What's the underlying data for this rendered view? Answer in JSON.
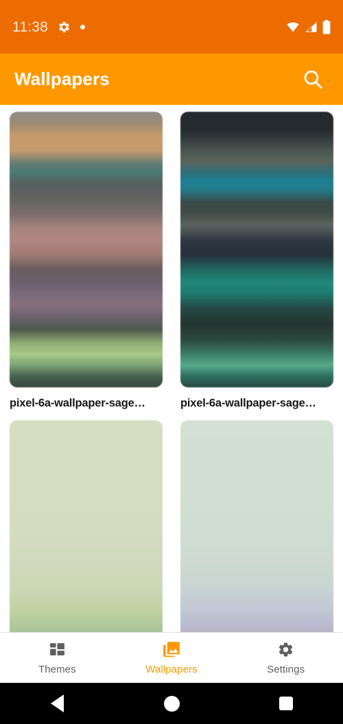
{
  "status_bar": {
    "time": "11:38",
    "icons": [
      "gear-icon",
      "dot-indicator",
      "wifi-icon",
      "cellular-signal-icon",
      "battery-icon"
    ],
    "background_color": "#EC6C02"
  },
  "app_bar": {
    "title": "Wallpapers",
    "search_icon": "search-icon",
    "background_color": "#FF9800",
    "title_color": "#FFFFFF"
  },
  "wallpaper_grid": {
    "items": [
      {
        "label": "pixel-6a-wallpaper-sage…"
      },
      {
        "label": "pixel-6a-wallpaper-sage…"
      },
      {
        "label": ""
      },
      {
        "label": ""
      }
    ]
  },
  "bottom_nav": {
    "active_color": "#FF9800",
    "inactive_color": "#5F5F5F",
    "items": [
      {
        "label": "Themes",
        "icon": "dashboard-grid-icon",
        "active": false
      },
      {
        "label": "Wallpapers",
        "icon": "photo-library-icon",
        "active": true
      },
      {
        "label": "Settings",
        "icon": "gear-icon",
        "active": false
      }
    ]
  },
  "system_nav": {
    "buttons": [
      "back-button",
      "home-button",
      "recents-button"
    ]
  }
}
